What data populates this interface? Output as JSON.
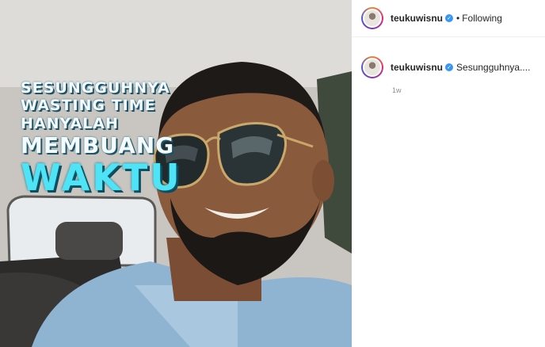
{
  "post": {
    "overlay_text": {
      "line1": "SESUNGGUHNYA",
      "line2": "WASTING TIME",
      "line3": "HANYALAH",
      "line4": "MEMBUANG",
      "line5": "WAKTU"
    }
  },
  "header": {
    "username": "teukuwisnu",
    "separator": "•",
    "follow_state": "Following",
    "verified_mark": "✓"
  },
  "caption": {
    "username": "teukuwisnu",
    "text": "Sesungguhnya....",
    "time": "1w",
    "verified_mark": "✓"
  },
  "colors": {
    "overlay_accent": "#4fe3f6",
    "verified_badge": "#3897f0",
    "timestamp": "#8e8e8e"
  }
}
